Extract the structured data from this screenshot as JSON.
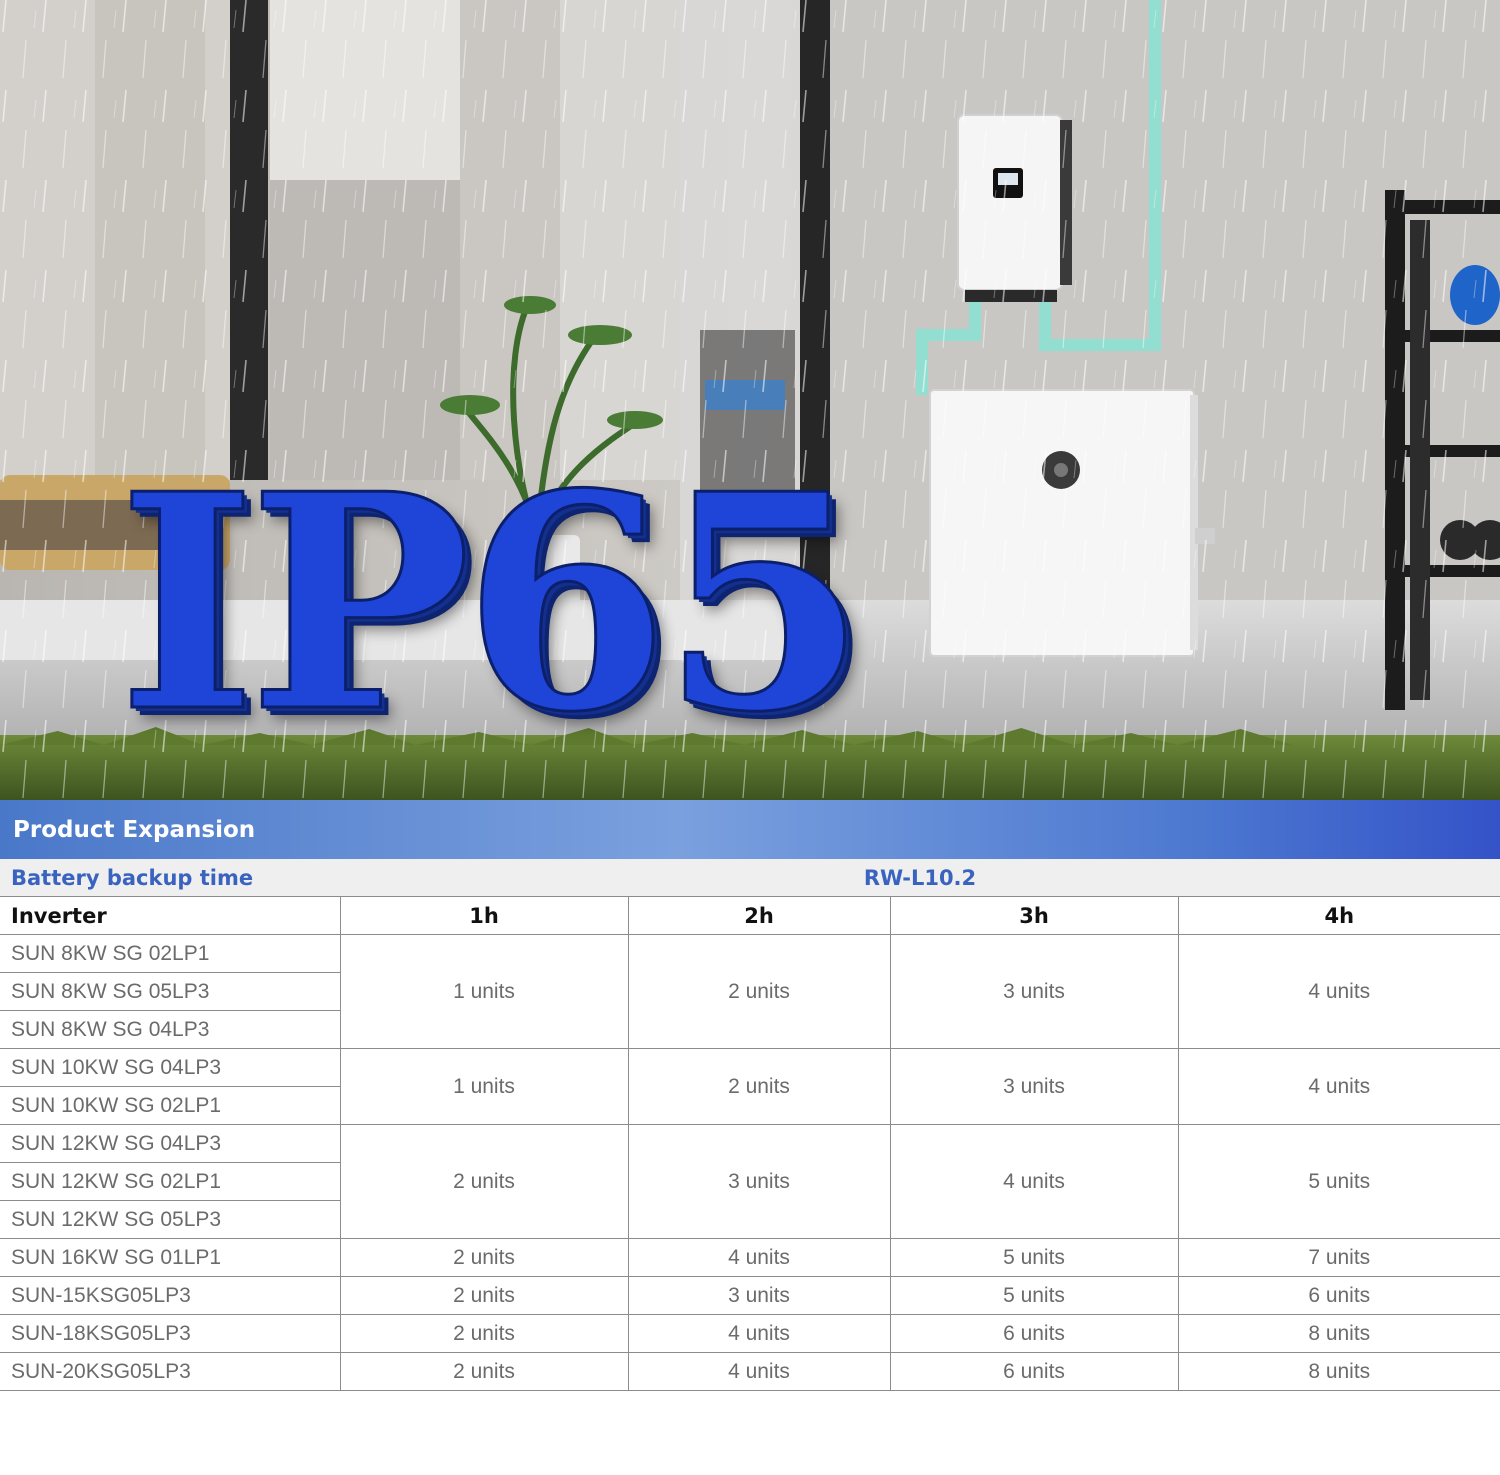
{
  "hero": {
    "headline": "IP65"
  },
  "banner": {
    "title": "Product Expansion"
  },
  "table": {
    "row_label": "Battery backup time",
    "model": "RW-L10.2",
    "inverter_header": "Inverter",
    "durations": [
      "1h",
      "2h",
      "3h",
      "4h"
    ],
    "groups": [
      {
        "inverters": [
          "SUN 8KW SG 02LP1",
          "SUN 8KW SG 05LP3",
          "SUN 8KW SG 04LP3"
        ],
        "units": [
          "1 units",
          "2 units",
          "3 units",
          "4 units"
        ]
      },
      {
        "inverters": [
          "SUN 10KW SG 04LP3",
          "SUN 10KW SG 02LP1"
        ],
        "units": [
          "1 units",
          "2 units",
          "3 units",
          "4 units"
        ]
      },
      {
        "inverters": [
          "SUN 12KW SG 04LP3",
          "SUN 12KW SG 02LP1",
          "SUN 12KW SG 05LP3"
        ],
        "units": [
          "2 units",
          "3 units",
          "4 units",
          "5 units"
        ]
      },
      {
        "inverters": [
          "SUN 16KW SG 01LP1"
        ],
        "units": [
          "2 units",
          "4 units",
          "5 units",
          "7 units"
        ]
      },
      {
        "inverters": [
          "SUN-15KSG05LP3"
        ],
        "units": [
          "2 units",
          "3 units",
          "5 units",
          "6 units"
        ]
      },
      {
        "inverters": [
          "SUN-18KSG05LP3"
        ],
        "units": [
          "2 units",
          "4 units",
          "6 units",
          "8 units"
        ]
      },
      {
        "inverters": [
          "SUN-20KSG05LP3"
        ],
        "units": [
          "2 units",
          "4 units",
          "6 units",
          "8 units"
        ]
      }
    ]
  }
}
